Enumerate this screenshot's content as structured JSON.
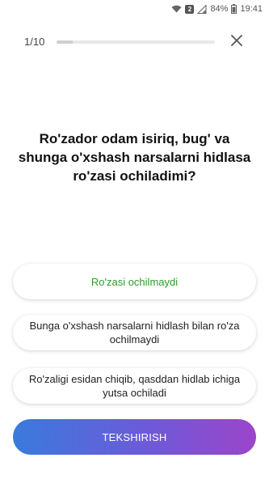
{
  "status_bar": {
    "sim_label": "2",
    "battery": "84%",
    "time": "19:41"
  },
  "header": {
    "progress_text": "1/10",
    "progress_fraction": 0.1
  },
  "question": {
    "text": "Ro'zador odam isiriq, bug' va shunga o'xshash narsalarni hidlasa ro'zasi ochiladimi?"
  },
  "options": [
    {
      "label": "Ro'zasi ochilmaydi",
      "selected": true
    },
    {
      "label": "Bunga o'xshash narsalarni hidlash bilan ro'za ochilmaydi",
      "selected": false
    },
    {
      "label": "Ro'zaligi esidan chiqib, qasddan hidlab ichiga yutsa ochiladi",
      "selected": false
    }
  ],
  "submit": {
    "label": "TEKSHIRISH"
  },
  "colors": {
    "selected_text": "#2a9d2a",
    "button_gradient_start": "#3a7bdc",
    "button_gradient_end": "#9b45c9"
  },
  "icons": {
    "wifi": "wifi-icon",
    "sim": "sim-icon",
    "signal": "signal-icon",
    "battery": "battery-icon",
    "close": "close-icon"
  }
}
